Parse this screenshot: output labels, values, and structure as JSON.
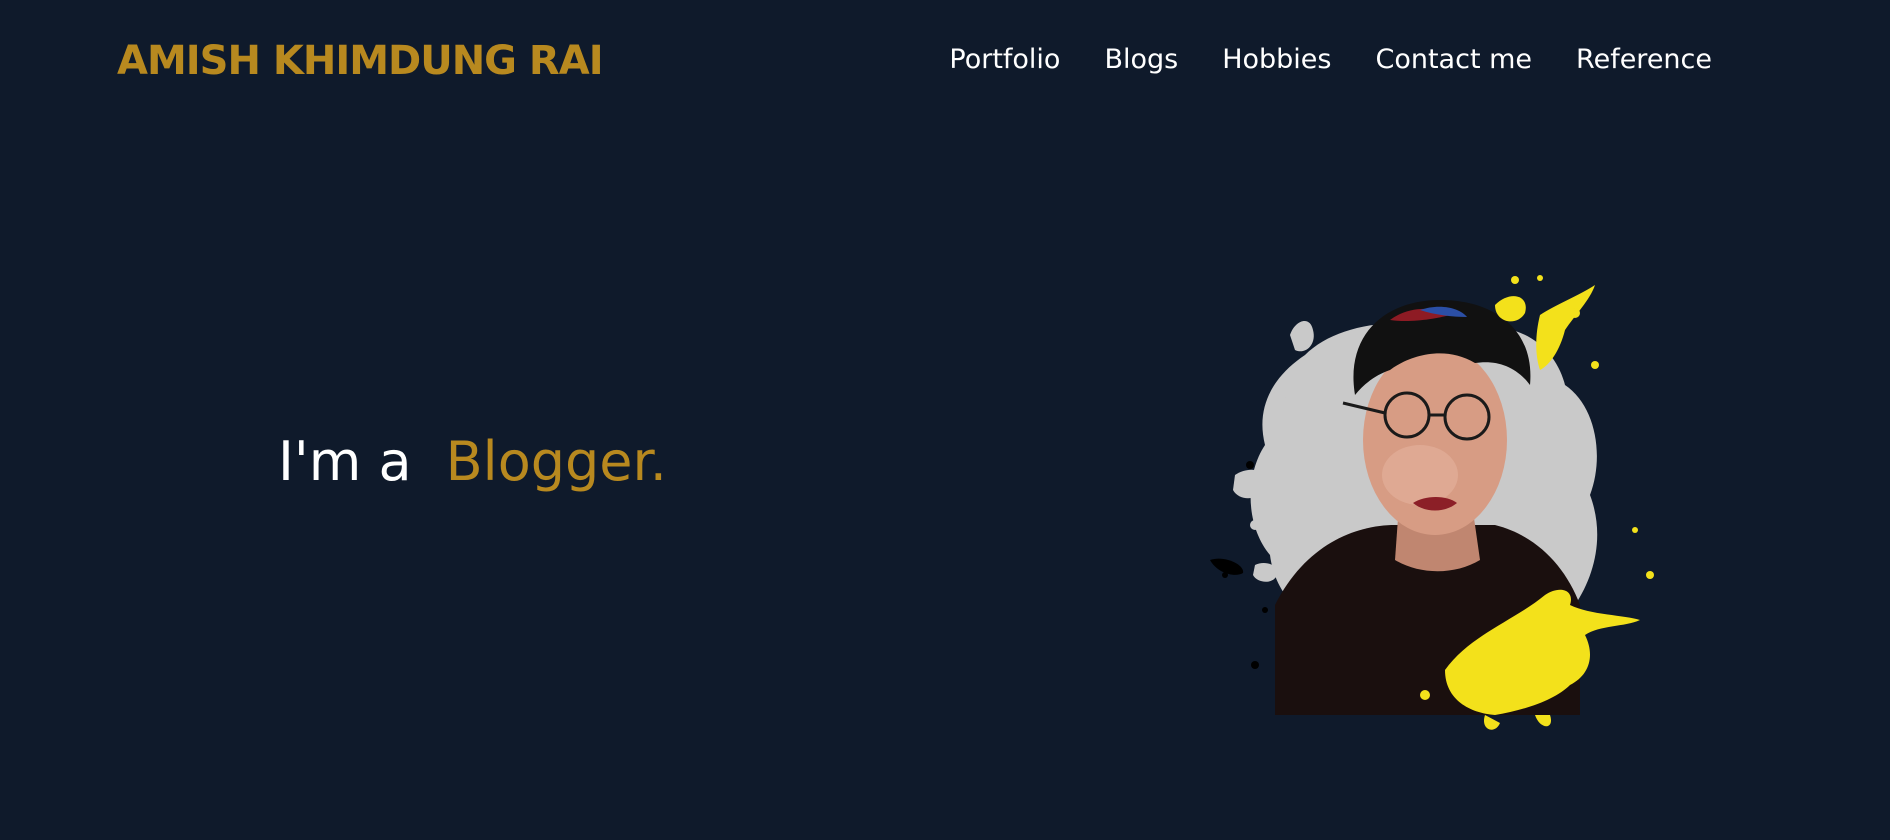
{
  "header": {
    "brand": "AMISH KHIMDUNG RAI",
    "nav": [
      {
        "label": "Portfolio"
      },
      {
        "label": "Blogs"
      },
      {
        "label": "Hobbies"
      },
      {
        "label": "Contact me"
      },
      {
        "label": "Reference"
      }
    ]
  },
  "hero": {
    "prefix": "I'm a",
    "role": "Blogger."
  },
  "colors": {
    "background": "#0f1a2b",
    "accent": "#b8891f",
    "text": "#ffffff",
    "splash_yellow": "#f3e11b"
  }
}
